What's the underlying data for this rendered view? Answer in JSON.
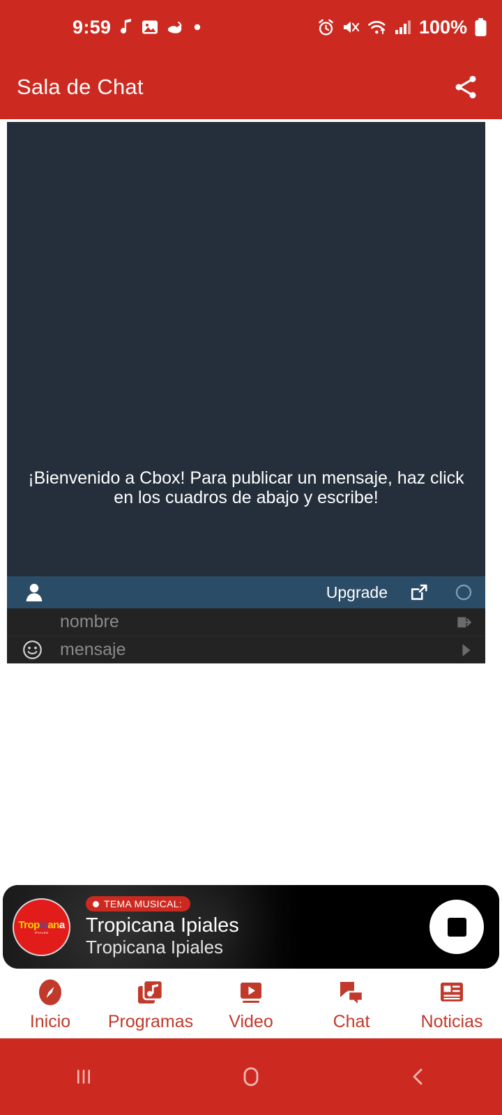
{
  "status_bar": {
    "time": "9:59",
    "battery_text": "100%",
    "left_icons": [
      "music-note-icon",
      "image-icon",
      "cleaner-icon",
      "dot-icon"
    ],
    "right_icons": [
      "alarm-icon",
      "mute-vibrate-icon",
      "wifi-icon",
      "signal-icon",
      "battery-icon"
    ]
  },
  "app_bar": {
    "title": "Sala de Chat",
    "share_label": "share-icon"
  },
  "chat_widget": {
    "welcome_message": "¡Bienvenido a Cbox! Para publicar un mensaje, haz click en los cuadros de abajo y escribe!",
    "toolbar": {
      "user_icon": "user-icon",
      "upgrade_label": "Upgrade",
      "popout_icon": "popout-icon",
      "refresh_icon": "circle-icon"
    },
    "name_input": {
      "placeholder": "nombre",
      "submit_icon": "login-arrow-icon"
    },
    "message_input": {
      "placeholder": "mensaje",
      "emoji_icon": "smiley-icon",
      "send_icon": "send-triangle-icon"
    },
    "colors": {
      "background": "#242f3b",
      "toolbar": "#2b4c66",
      "inputs": "#232323"
    }
  },
  "player": {
    "badge_label": "TEMA MUSICAL:",
    "track_title": "Tropicana Ipiales",
    "track_subtitle": "Tropicana Ipiales",
    "stop_button": "stop-button",
    "logo": {
      "part1": "Trop",
      "part2": "ic",
      "part3": "an",
      "part4": "a",
      "tagline": "IPIALES"
    }
  },
  "bottom_nav": {
    "accent_color": "#c0392b",
    "items": [
      {
        "label": "Inicio",
        "icon": "compass-icon"
      },
      {
        "label": "Programas",
        "icon": "music-library-icon"
      },
      {
        "label": "Video",
        "icon": "video-play-icon"
      },
      {
        "label": "Chat",
        "icon": "chat-bubbles-icon"
      },
      {
        "label": "Noticias",
        "icon": "news-icon"
      }
    ]
  },
  "system_nav": {
    "background": "#cc2a20",
    "buttons": [
      {
        "name": "recents-button",
        "icon": "recents-icon"
      },
      {
        "name": "home-button",
        "icon": "home-circle-icon"
      },
      {
        "name": "back-button",
        "icon": "back-chevron-icon"
      }
    ]
  }
}
